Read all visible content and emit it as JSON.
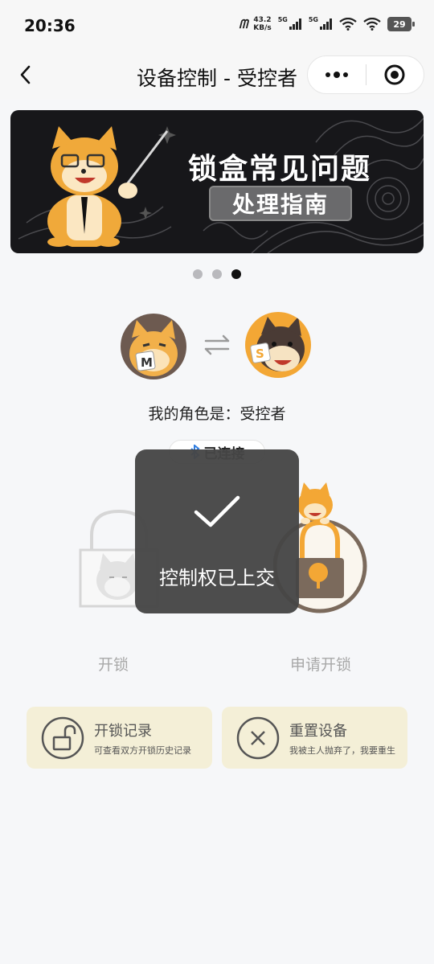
{
  "status_bar": {
    "time": "20:36",
    "net_speed_value": "43.2",
    "net_speed_unit": "KB/s",
    "signal_1": "5G",
    "signal_2": "5G",
    "battery": "29"
  },
  "nav": {
    "title": "设备控制 - 受控者"
  },
  "banner": {
    "title": "锁盒常见问题",
    "subtitle": "处理指南",
    "page_count": 3,
    "active_index": 2
  },
  "role": {
    "avatar_left_badge": "M",
    "avatar_right_badge": "S",
    "text": "我的角色是：受控者",
    "pill_label": "已连接"
  },
  "actions": {
    "unlock_label": "开锁",
    "request_unlock_label": "申请开锁"
  },
  "cards": [
    {
      "title": "开锁记录",
      "desc": "可查看双方开锁历史记录"
    },
    {
      "title": "重置设备",
      "desc": "我被主人抛弃了，我要重生"
    }
  ],
  "toast": {
    "text": "控制权已上交"
  },
  "colors": {
    "accent_orange": "#f3a735",
    "card_bg": "#f4efd7",
    "banner_bg": "#17171a",
    "toast_bg": "#464646"
  }
}
